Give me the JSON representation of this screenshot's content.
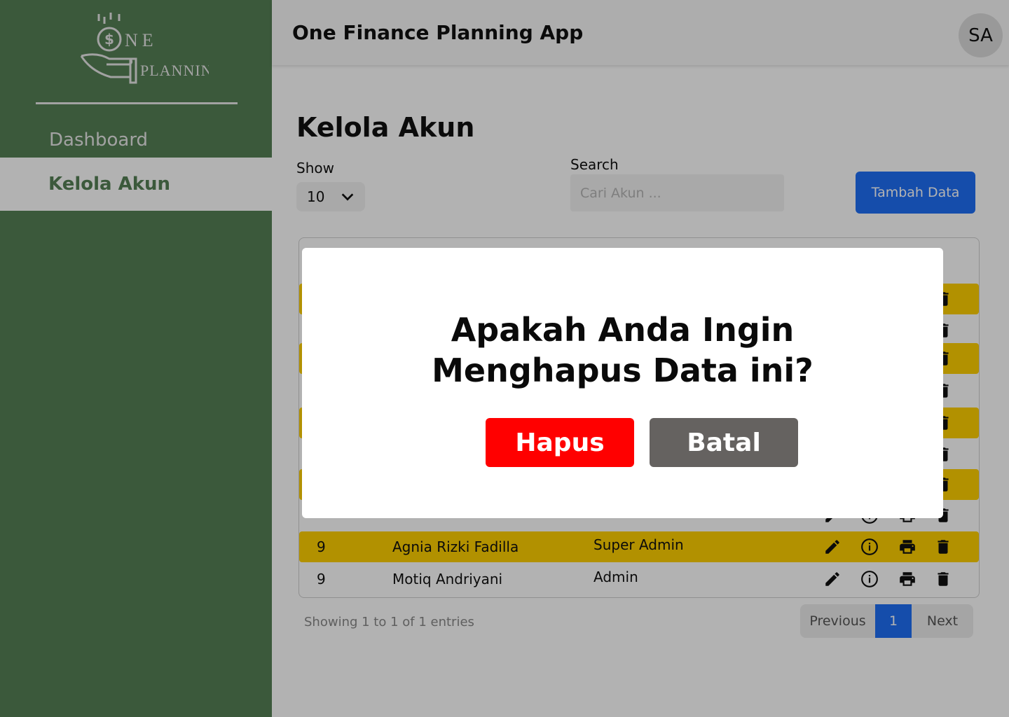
{
  "app": {
    "title": "One Finance Planning App",
    "avatar_initials": "SA",
    "logo_text_top": "NE",
    "logo_text_bottom": "PLANNING"
  },
  "sidebar": {
    "items": [
      {
        "label": "Dashboard",
        "active": false
      },
      {
        "label": "Kelola Akun",
        "active": true
      }
    ]
  },
  "main": {
    "page_title": "Kelola Akun",
    "show": {
      "label": "Show",
      "value": "10"
    },
    "search": {
      "label": "Search",
      "placeholder": "Cari Akun ..."
    },
    "add_button": "Tambah Data",
    "table": {
      "rows": [
        {
          "no": "",
          "name": "",
          "role": "",
          "highlight": true
        },
        {
          "no": "",
          "name": "",
          "role": "",
          "highlight": false
        },
        {
          "no": "",
          "name": "",
          "role": "",
          "highlight": true
        },
        {
          "no": "",
          "name": "",
          "role": "",
          "highlight": false
        },
        {
          "no": "",
          "name": "",
          "role": "",
          "highlight": true
        },
        {
          "no": "",
          "name": "",
          "role": "",
          "highlight": false
        },
        {
          "no": "",
          "name": "",
          "role": "",
          "highlight": true
        },
        {
          "no": "",
          "name": "",
          "role": "",
          "highlight": false
        },
        {
          "no": "9",
          "name": "Agnia Rizki Fadilla",
          "role": "Super Admin",
          "highlight": true
        },
        {
          "no": "9",
          "name": "Motiq Andriyani",
          "role": "Admin",
          "highlight": false
        }
      ],
      "actions": [
        "edit-icon",
        "info-icon",
        "print-icon",
        "trash-icon"
      ]
    },
    "footer_info": "Showing 1 to 1 of 1 entries",
    "pagination": {
      "previous": "Previous",
      "current": "1",
      "next": "Next"
    }
  },
  "modal": {
    "message": "Apakah Anda Ingin Menghapus Data ini?",
    "confirm_label": "Hapus",
    "cancel_label": "Batal"
  },
  "colors": {
    "sidebar_bg": "#558055",
    "accent_blue": "#1f6ff5",
    "row_highlight": "#ffd000",
    "danger": "#ff0000",
    "neutral_button": "#656260",
    "overlay": "rgba(0,0,0,0.3)"
  }
}
